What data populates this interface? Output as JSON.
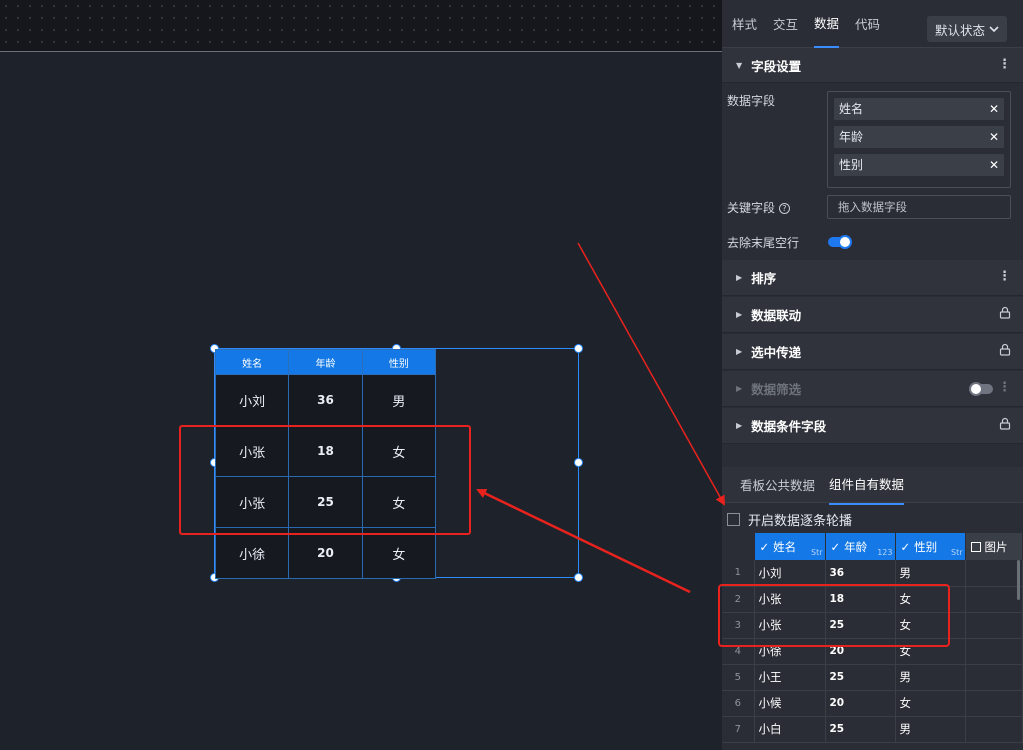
{
  "canvas": {
    "table": {
      "headers": [
        "姓名",
        "年龄",
        "性别"
      ],
      "rows": [
        [
          "小刘",
          "36",
          "男"
        ],
        [
          "小张",
          "18",
          "女"
        ],
        [
          "小张",
          "25",
          "女"
        ],
        [
          "小徐",
          "20",
          "女"
        ]
      ]
    }
  },
  "panel": {
    "tabs": [
      "样式",
      "交互",
      "数据",
      "代码"
    ],
    "active_tab": "数据",
    "state_select": "默认状态",
    "field_settings": {
      "title": "字段设置",
      "data_fields_label": "数据字段",
      "data_fields": [
        "姓名",
        "年龄",
        "性别"
      ],
      "key_field_label": "关键字段",
      "key_field_placeholder": "拖入数据字段",
      "trim_empty_label": "去除末尾空行"
    },
    "sections": [
      "排序",
      "数据联动",
      "选中传递",
      "数据筛选",
      "数据条件字段"
    ],
    "data_tabs": [
      "看板公共数据",
      "组件自有数据"
    ],
    "carousel_label": "开启数据逐条轮播",
    "grid": {
      "columns": [
        {
          "name": "姓名",
          "type": "Str"
        },
        {
          "name": "年龄",
          "type": "123"
        },
        {
          "name": "性别",
          "type": "Str"
        },
        {
          "name": "图片",
          "type": ""
        }
      ],
      "rows": [
        [
          "1",
          "小刘",
          "36",
          "男"
        ],
        [
          "2",
          "小张",
          "18",
          "女"
        ],
        [
          "3",
          "小张",
          "25",
          "女"
        ],
        [
          "4",
          "小徐",
          "20",
          "女"
        ],
        [
          "5",
          "小王",
          "25",
          "男"
        ],
        [
          "6",
          "小候",
          "20",
          "女"
        ],
        [
          "7",
          "小白",
          "25",
          "男"
        ]
      ]
    }
  },
  "colors": {
    "accent": "#1479e6",
    "highlight": "#e8231d",
    "background": "#1e222b",
    "panel": "#2a2d35"
  }
}
